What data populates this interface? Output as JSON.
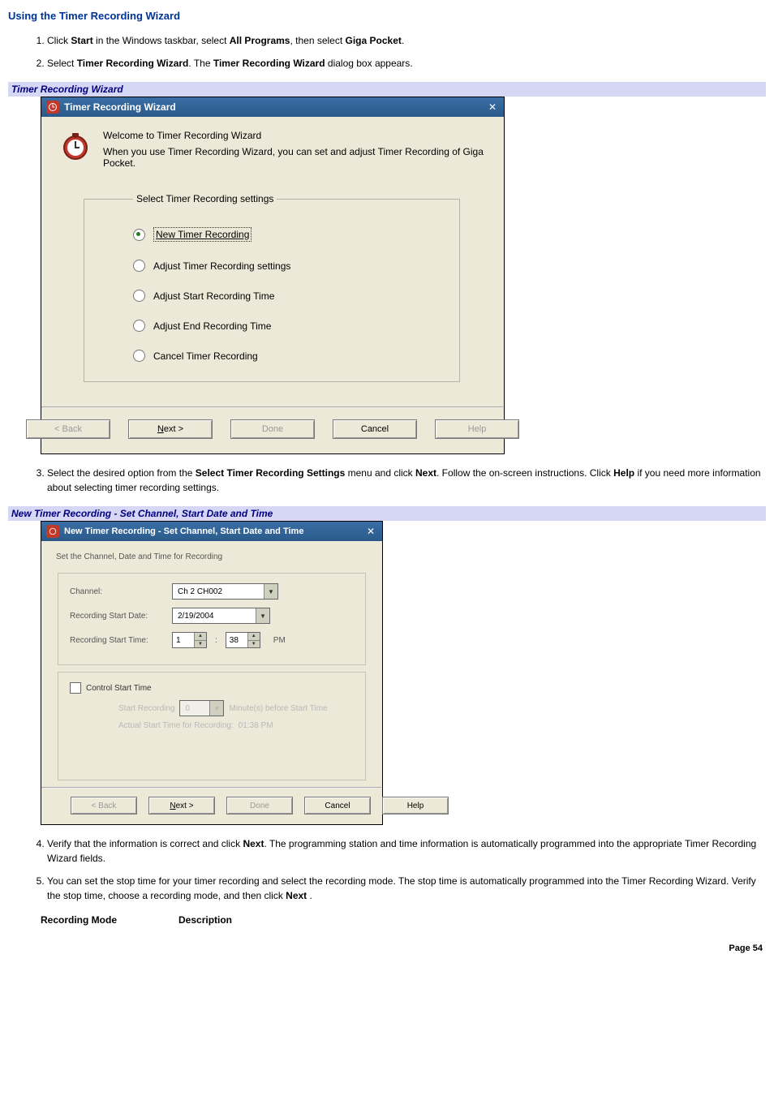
{
  "heading": "Using the Timer Recording Wizard",
  "steps": {
    "s1_a": "Click ",
    "s1_b": "Start",
    "s1_c": " in the Windows taskbar, select ",
    "s1_d": "All Programs",
    "s1_e": ", then select ",
    "s1_f": "Giga Pocket",
    "s1_g": ".",
    "s2_a": "Select ",
    "s2_b": "Timer Recording Wizard",
    "s2_c": ". The ",
    "s2_d": "Timer Recording Wizard",
    "s2_e": " dialog box appears.",
    "s3_a": "Select the desired option from the ",
    "s3_b": "Select Timer Recording Settings",
    "s3_c": " menu and click ",
    "s3_d": "Next",
    "s3_e": ". Follow the on-screen instructions. Click ",
    "s3_f": "Help",
    "s3_g": " if you need more information about selecting timer recording settings.",
    "s4_a": "Verify that the information is correct and click ",
    "s4_b": "Next",
    "s4_c": ". The programming station and time information is automatically programmed into the appropriate Timer Recording Wizard fields.",
    "s5_a": "You can set the stop time for your timer recording and select the recording mode. The stop time is automatically programmed into the Timer Recording Wizard. Verify the stop time, choose a recording mode, and then click ",
    "s5_b": "Next",
    "s5_c": " ."
  },
  "caption1": "Timer Recording Wizard",
  "dlg1": {
    "title": "Timer Recording Wizard",
    "welcome1": "Welcome to Timer Recording Wizard",
    "welcome2": "When you use Timer Recording Wizard, you can set and adjust Timer Recording of Giga Pocket.",
    "group_legend": "Select Timer Recording settings",
    "opt1": "New Timer Recording",
    "opt2": "Adjust Timer Recording settings",
    "opt3": "Adjust Start Recording Time",
    "opt4": "Adjust End Recording Time",
    "opt5": "Cancel Timer Recording",
    "btn_back": "< Back",
    "btn_next_u": "N",
    "btn_next_rest": "ext >",
    "btn_done": "Done",
    "btn_cancel": "Cancel",
    "btn_help": "Help"
  },
  "caption2": "New Timer Recording - Set Channel, Start Date and Time",
  "dlg2": {
    "title": "New Timer Recording - Set Channel, Start Date and Time",
    "subtitle": "Set the Channel, Date and Time for Recording",
    "lab_channel": "Channel:",
    "val_channel": "Ch 2 CH002",
    "lab_start_date": "Recording Start Date:",
    "val_start_date": "2/19/2004",
    "lab_start_time": "Recording Start Time:",
    "val_hour": "1",
    "val_min": "38",
    "ampm": "PM",
    "cst_label": "Control Start Time",
    "sr_label": "Start Recording",
    "sr_val": "0",
    "sr_after": "Minute(s) before Start Time",
    "actual_label": "Actual Start Time for Recording:",
    "actual_val": "01:38 PM",
    "btn_back": "< Back",
    "btn_next_u": "N",
    "btn_next_rest": "ext >",
    "btn_done": "Done",
    "btn_cancel": "Cancel",
    "btn_help": "Help"
  },
  "table": {
    "col1": "Recording Mode",
    "col2": "Description"
  },
  "footer": "Page 54"
}
